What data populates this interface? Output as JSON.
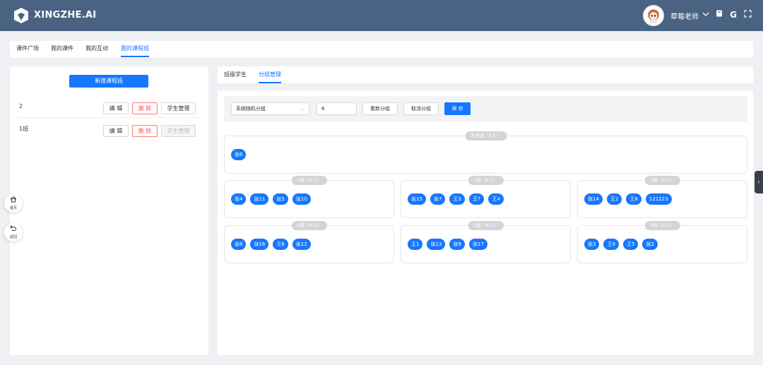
{
  "header": {
    "brand": "XINGZHE.AI",
    "username": "草莓老师",
    "icons": [
      "chevron-down-icon",
      "book-icon",
      "google-icon",
      "fullscreen-icon"
    ]
  },
  "topnav": {
    "tabs": [
      "课件广场",
      "我的课件",
      "我的互动",
      "我的课程班"
    ],
    "active": "我的课程班"
  },
  "left": {
    "new_button": "新增课程班",
    "classes": [
      {
        "name": "2",
        "edit": "编 辑",
        "delete": "删 除",
        "manage": "学生管理",
        "manage_disabled": false
      },
      {
        "name": "1班",
        "edit": "编 辑",
        "delete": "删 除",
        "manage": "学生管理",
        "manage_disabled": true
      }
    ]
  },
  "side": {
    "home": "首页",
    "back": "返回"
  },
  "subnav": {
    "tabs": [
      "班级学生",
      "分组管理"
    ],
    "active": "分组管理"
  },
  "toolbar": {
    "mode": "系统随机分组",
    "count": "6",
    "regroup": "重新分组",
    "cancel": "取消分组",
    "save": "保 存"
  },
  "ungrouped": {
    "label": "未分组（1人）",
    "members": [
      "张6"
    ]
  },
  "groups": [
    {
      "label": "1组（4人）",
      "members": [
        "张4",
        "张11",
        "张5",
        "张10"
      ]
    },
    {
      "label": "2组（5人）",
      "members": [
        "张15",
        "张7",
        "王3",
        "王7",
        "王4"
      ]
    },
    {
      "label": "3组（4人）",
      "members": [
        "张14",
        "王2",
        "王8",
        "121223"
      ]
    },
    {
      "label": "4组（4人）",
      "members": [
        "张8",
        "张16",
        "王6",
        "张12"
      ]
    },
    {
      "label": "5组（4人）",
      "members": [
        "王1",
        "张13",
        "张9",
        "张17"
      ]
    },
    {
      "label": "6组（4人）",
      "members": [
        "张3",
        "王9",
        "王5",
        "张2"
      ]
    }
  ],
  "colors": {
    "header": "#4a6382",
    "primary": "#1677ff",
    "danger": "#ff4d4f"
  }
}
